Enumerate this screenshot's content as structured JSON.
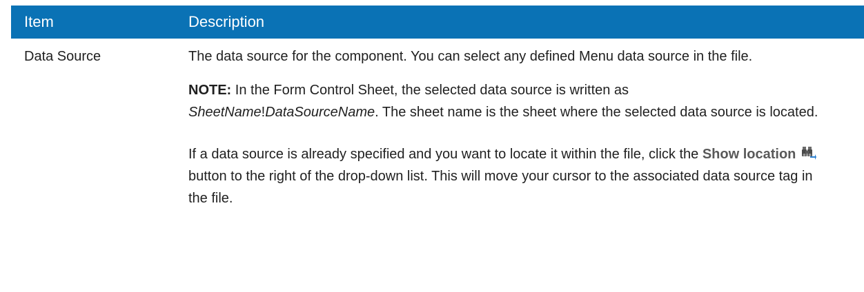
{
  "table": {
    "headers": {
      "item": "Item",
      "description": "Description"
    },
    "row": {
      "item": "Data Source",
      "para1": "The data source for the component. You can select any defined Menu data source in the file.",
      "note": {
        "label": "NOTE:",
        "text_a": " In the Form Control Sheet, the selected data source is written as ",
        "sheet_name": "SheetName",
        "bang": "!",
        "ds_name": "DataSourceName",
        "text_b": ". The sheet name is the sheet where the selected data source is located."
      },
      "para3": {
        "text_a": "If a data source is already specified and you want to locate it within the file, click the ",
        "button_label": "Show location",
        "button_icon": "binoculars-icon",
        "text_b": " button to the right of the drop-down list. This will move your cursor to the associated data source tag in the file."
      }
    }
  },
  "colors": {
    "header_bg": "#0a72b5",
    "header_text": "#ffffff"
  }
}
